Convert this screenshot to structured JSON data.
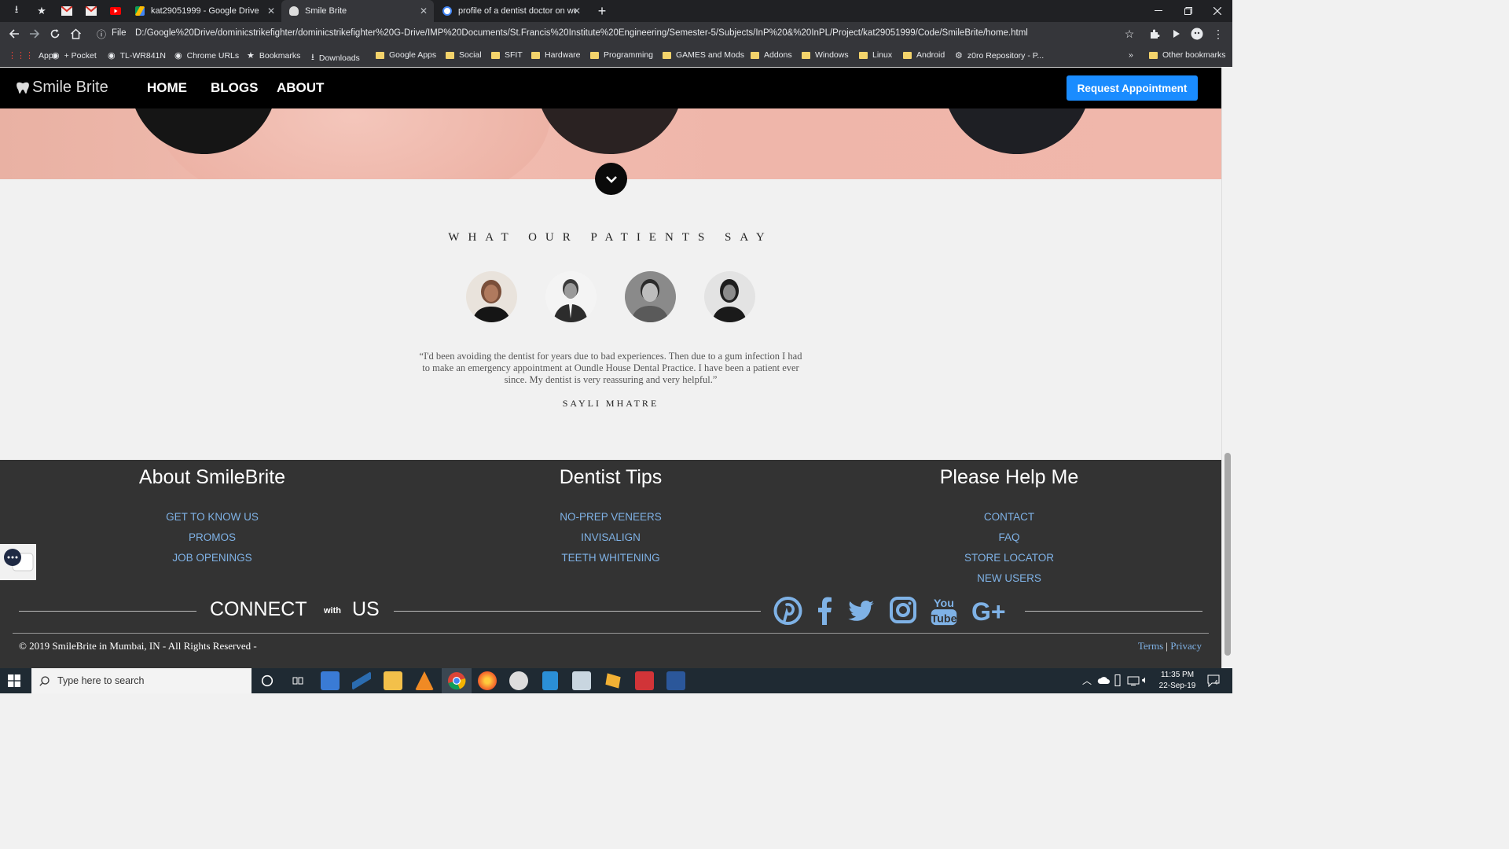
{
  "browser": {
    "tabs": [
      {
        "title": "kat29051999 - Google Drive",
        "active": false
      },
      {
        "title": "Smile Brite",
        "active": true
      },
      {
        "title": "profile of a dentist doctor on wel",
        "active": false
      }
    ],
    "new_tab_label": "+",
    "file_label": "File",
    "url": "D:/Google%20Drive/dominicstrikefighter/dominicstrikefighter%20G-Drive/IMP%20Documents/St.Francis%20Institute%20Engineering/Semester-5/Subjects/InP%20&%20InPL/Project/kat29051999/Code/SmileBrite/home.html",
    "bookmarks": [
      {
        "label": "Apps",
        "icon": "apps-grid-icon"
      },
      {
        "label": "+ Pocket",
        "icon": "globe-icon"
      },
      {
        "label": "TL-WR841N",
        "icon": "globe-icon"
      },
      {
        "label": "Chrome URLs",
        "icon": "globe-icon"
      },
      {
        "label": "Bookmarks",
        "icon": "star-icon"
      },
      {
        "label": "Downloads",
        "icon": "download-icon"
      },
      {
        "label": "Google Apps",
        "icon": "folder-icon"
      },
      {
        "label": "Social",
        "icon": "folder-icon"
      },
      {
        "label": "SFIT",
        "icon": "folder-icon"
      },
      {
        "label": "Hardware",
        "icon": "folder-icon"
      },
      {
        "label": "Programming",
        "icon": "folder-icon"
      },
      {
        "label": "GAMES and Mods",
        "icon": "folder-icon"
      },
      {
        "label": "Addons",
        "icon": "folder-icon"
      },
      {
        "label": "Windows",
        "icon": "folder-icon"
      },
      {
        "label": "Linux",
        "icon": "folder-icon"
      },
      {
        "label": "Android",
        "icon": "folder-icon"
      },
      {
        "label": "z0ro Repository - P...",
        "icon": "satellite-icon"
      }
    ],
    "bookmarks_overflow": "»",
    "other_bookmarks": "Other bookmarks"
  },
  "site": {
    "logo": "Smile Brite",
    "nav": {
      "home": "HOME",
      "blogs": "BLOGS",
      "about": "ABOUT"
    },
    "request_button": "Request Appointment",
    "accent_color": "#1a8cff",
    "testimonials": {
      "heading": "WHAT OUR PATIENTS SAY",
      "quote": "“I'd been avoiding the dentist for years due to bad experiences. Then due to a gum infection I had to make an emergency appointment at Oundle House Dental Practice. I have been a patient ever since. My dentist is very reassuring and very helpful.”",
      "author": "SAYLI MHATRE"
    },
    "footer": {
      "col1": {
        "title": "About SmileBrite",
        "links": [
          "GET TO KNOW US",
          "PROMOS",
          "JOB OPENINGS"
        ]
      },
      "col2": {
        "title": "Dentist Tips",
        "links": [
          "NO-PREP VENEERS",
          "INVISALIGN",
          "TEETH WHITENING"
        ]
      },
      "col3": {
        "title": "Please Help Me",
        "links": [
          "CONTACT",
          "FAQ",
          "STORE LOCATOR",
          "NEW USERS"
        ]
      },
      "connect": {
        "word1": "CONNECT",
        "with": "with",
        "word2": "US"
      },
      "social": [
        "pinterest-icon",
        "facebook-icon",
        "twitter-icon",
        "instagram-icon",
        "youtube-icon",
        "google-plus-icon"
      ],
      "youtube_text": {
        "you": "You",
        "tube": "Tube"
      },
      "gplus_text": "G+",
      "copyright": "2019 SmileBrite in Mumbai, IN - All Rights Reserved -",
      "terms": "Terms",
      "separator": "|",
      "privacy": "Privacy"
    }
  },
  "taskbar": {
    "search_placeholder": "Type here to search",
    "time": "11:35 PM",
    "date": "22-Sep-19",
    "notification_count": "4"
  }
}
